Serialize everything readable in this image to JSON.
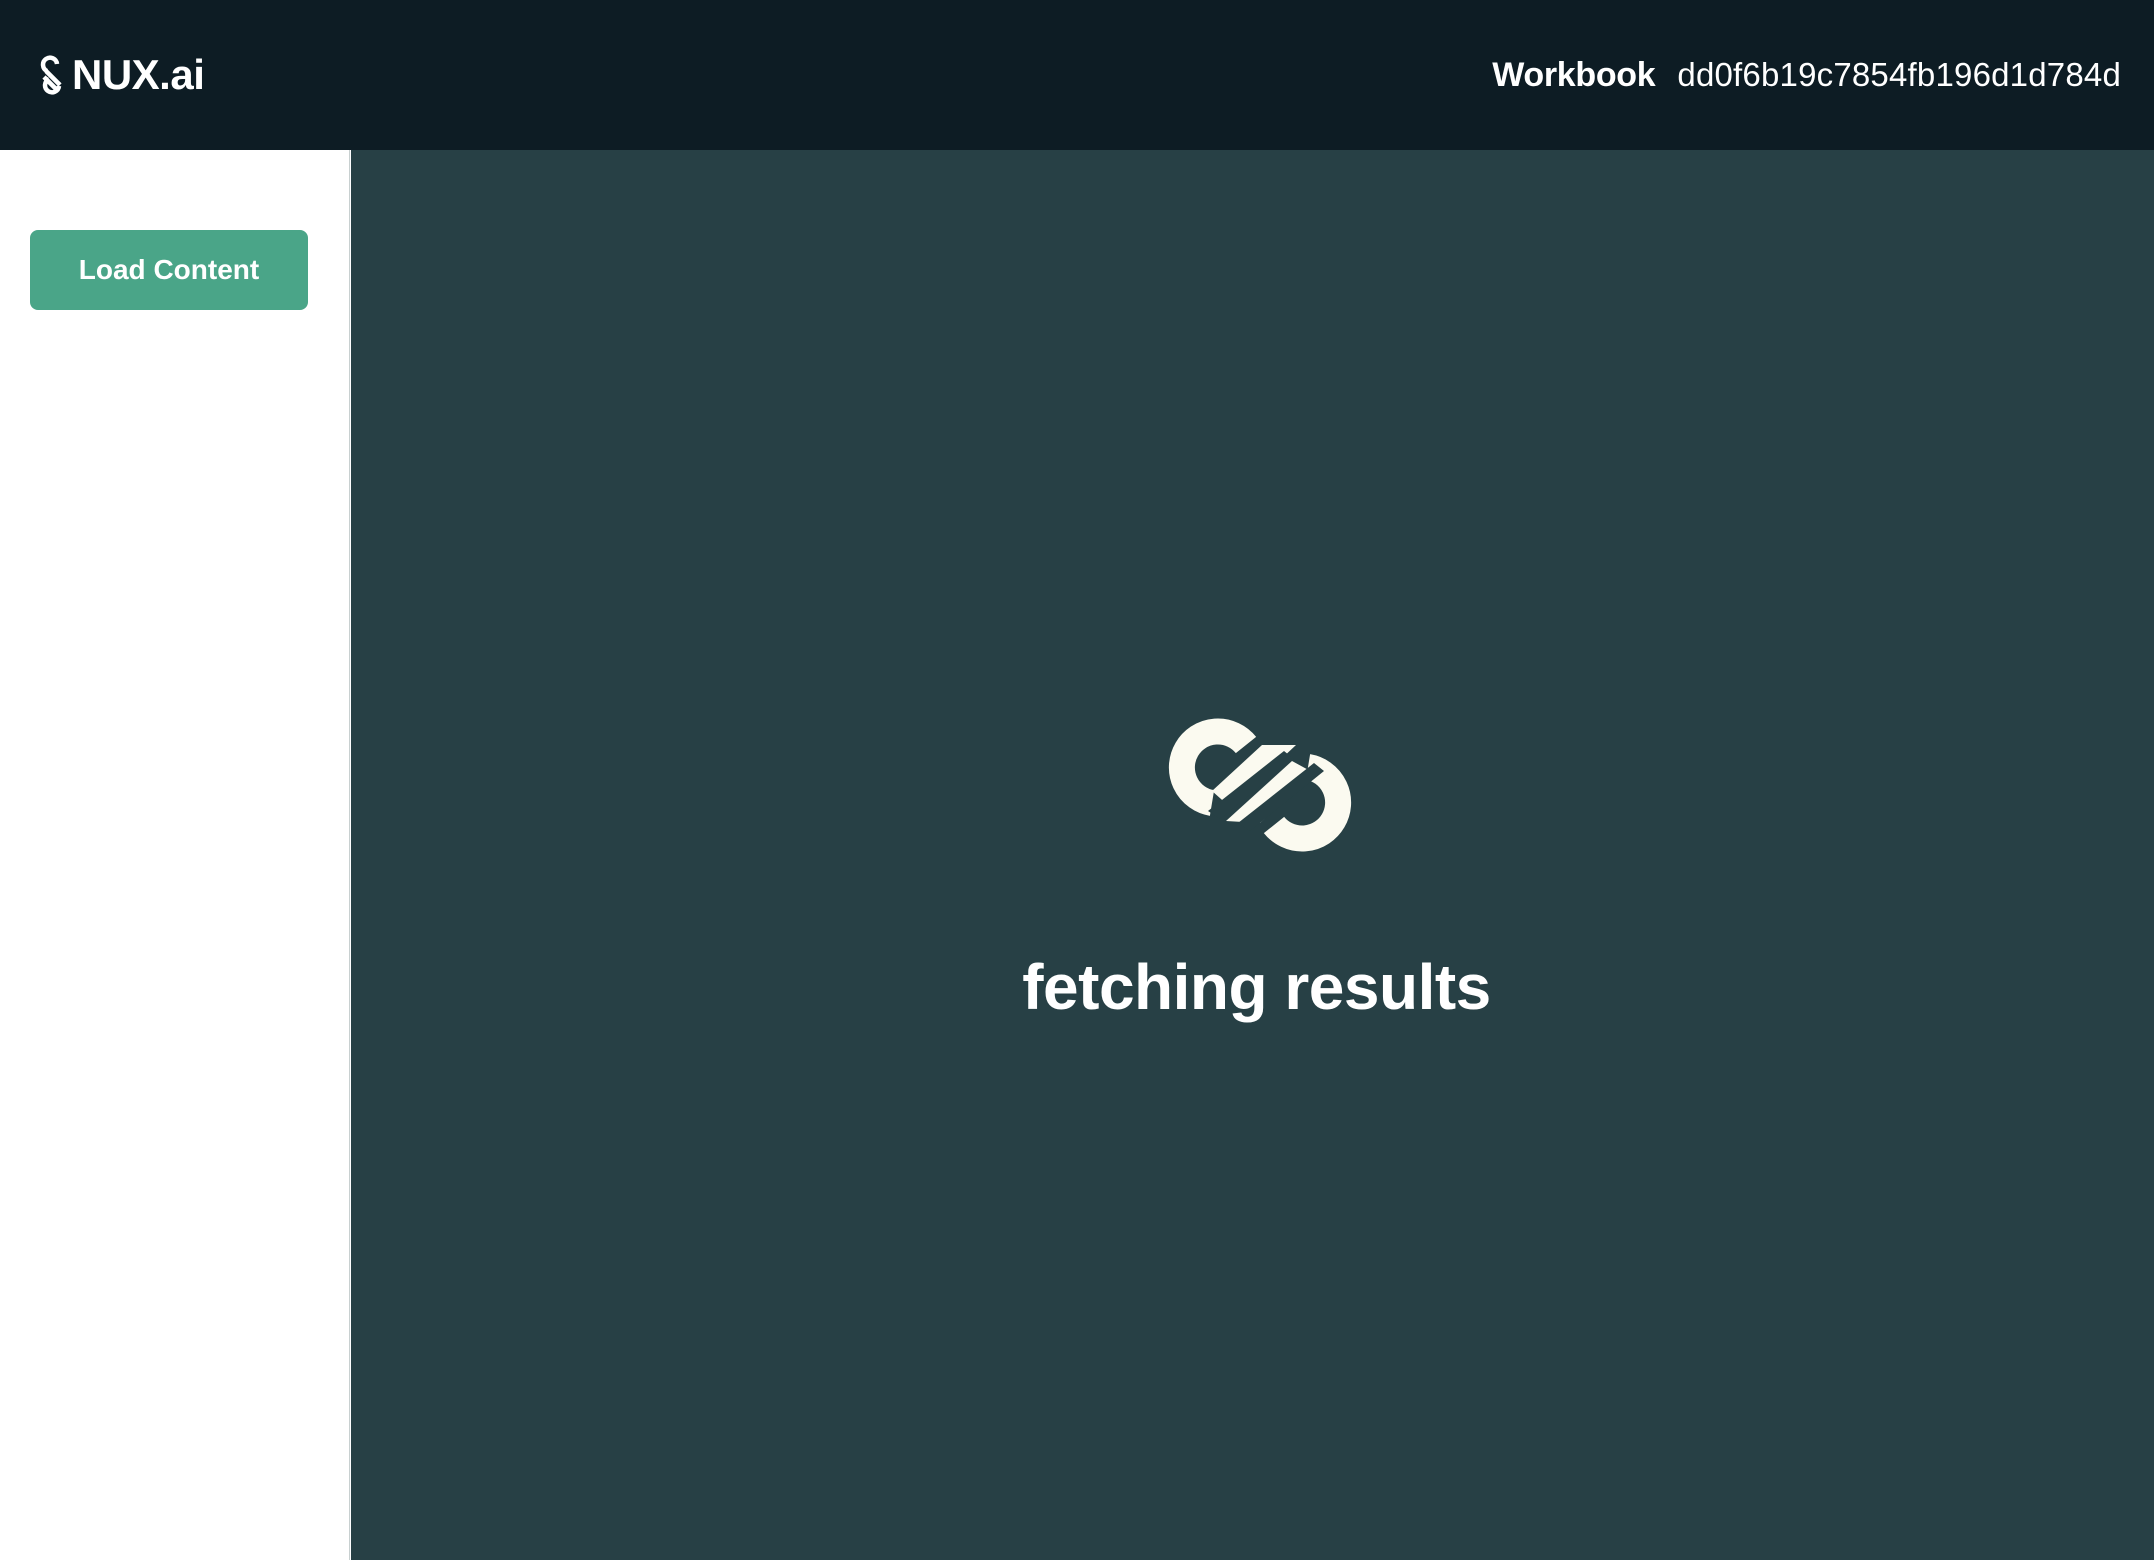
{
  "app": {
    "brand_name": "NUX.ai",
    "brand_icon": "nux-logo-icon"
  },
  "header": {
    "workbook_label": "Workbook",
    "workbook_id": "dd0f6b19c7854fb196d1d784d"
  },
  "sidebar": {
    "load_button_label": "Load Content"
  },
  "main": {
    "loader_icon": "nux-logo-icon",
    "status_text": "fetching results"
  },
  "colors": {
    "header_bg": "#0d1c24",
    "main_bg": "#274045",
    "accent": "#4aa588",
    "logo_fill": "#fbfaf0"
  }
}
